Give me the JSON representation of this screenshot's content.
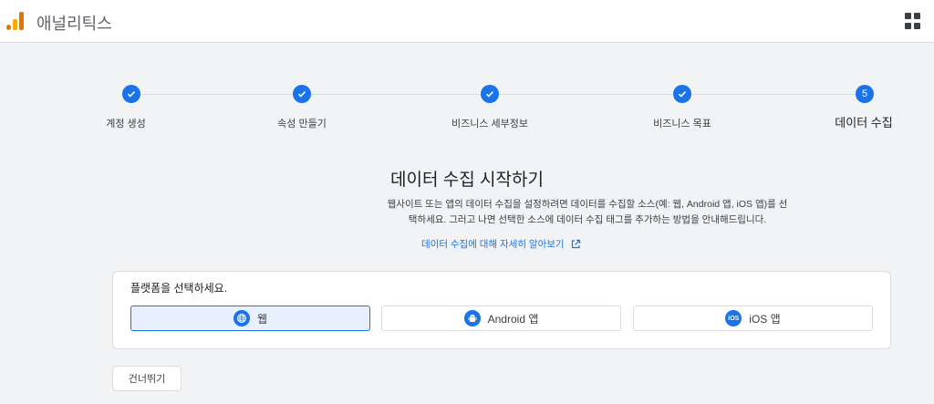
{
  "header": {
    "app_title": "애널리틱스",
    "apps_icon": "apps-grid-icon"
  },
  "colors": {
    "accent": "#1a73e8",
    "selected_bg": "#e8f0fe"
  },
  "stepper": {
    "steps": [
      {
        "label": "계정 생성",
        "status": "complete"
      },
      {
        "label": "속성 만들기",
        "status": "complete"
      },
      {
        "label": "비즈니스 세부정보",
        "status": "complete"
      },
      {
        "label": "비즈니스 목표",
        "status": "complete"
      },
      {
        "label": "데이터 수집",
        "status": "active",
        "number": "5"
      }
    ]
  },
  "main": {
    "heading": "데이터 수집 시작하기",
    "description": "웹사이트 또는 앱의 데이터 수집을 설정하려면 데이터를 수집할 소스(예: 웹, Android 앱, iOS 앱)를 선택하세요. 그러고 나면 선택한 소스에 데이터 수집 태그를 추가하는 방법을 안내해드립니다.",
    "learn_more": "데이터 수집에 대해 자세히 알아보기"
  },
  "platform_card": {
    "title": "플랫폼을 선택하세요.",
    "options": [
      {
        "label": "웹",
        "icon": "globe-icon",
        "selected": true
      },
      {
        "label": "Android 앱",
        "icon": "android-icon",
        "selected": false
      },
      {
        "label": "iOS 앱",
        "icon": "ios-icon",
        "icon_text": "iOS",
        "selected": false
      }
    ]
  },
  "footer": {
    "skip_label": "건너뛰기"
  }
}
